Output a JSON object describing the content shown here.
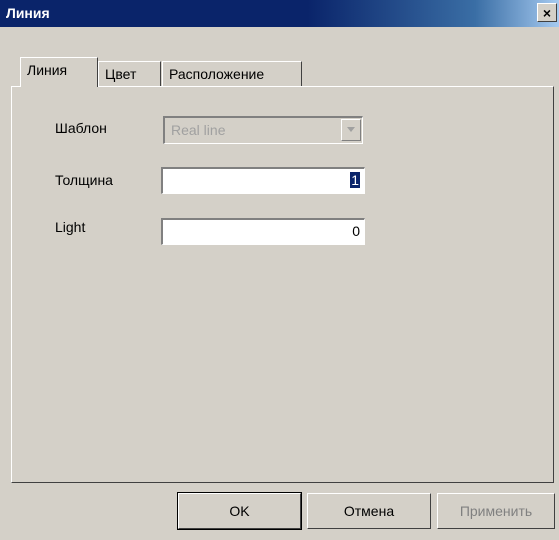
{
  "window": {
    "title": "Линия",
    "close_symbol": "×"
  },
  "tabs": [
    {
      "label": "Линия"
    },
    {
      "label": "Цвет"
    },
    {
      "label": "Расположение"
    }
  ],
  "form": {
    "template_label": "Шаблон",
    "template_value": "Real line",
    "thickness_label": "Толщина",
    "thickness_value": "1",
    "light_label": "Light",
    "light_value": "0"
  },
  "buttons": {
    "ok": "OK",
    "cancel": "Отмена",
    "apply": "Применить"
  }
}
